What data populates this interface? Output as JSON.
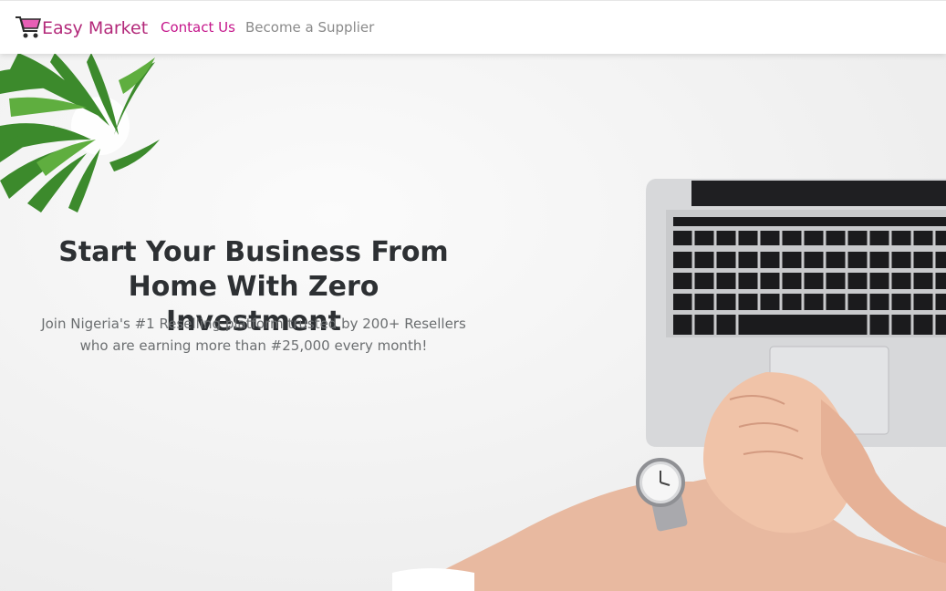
{
  "nav": {
    "brand": "Easy Market",
    "brand_icon": "shopping-cart-icon",
    "contact": "Contact Us",
    "supplier": "Become a Supplier"
  },
  "hero": {
    "title_line1": "Start Your Business From",
    "title_line2": "Home With Zero Investment",
    "subtitle_line1": "Join Nigeria's #1 Reselling platform trusted by 200+ Resellers",
    "subtitle_line2": "who are earning more than #25,000 every month!"
  },
  "colors": {
    "brand": "#b3297a",
    "accent": "#c5168b",
    "muted_link": "#8a8a8a"
  }
}
